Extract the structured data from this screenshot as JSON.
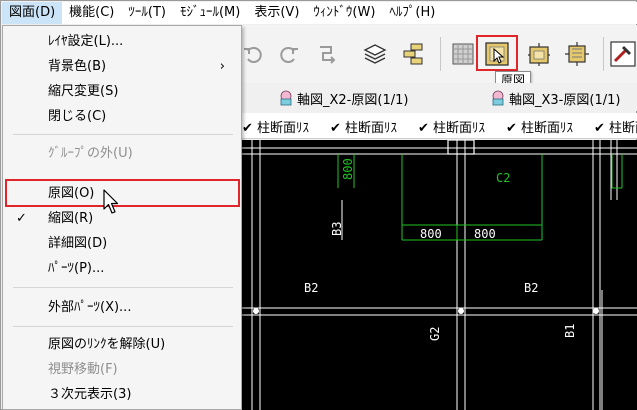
{
  "menubar": {
    "items": [
      "図面(D)",
      "機能(C)",
      "ﾂｰﾙ(T)",
      "ﾓｼﾞｭｰﾙ(M)",
      "表示(V)",
      "ｳｨﾝﾄﾞｳ(W)",
      "ﾍﾙﾌﾟ(H)"
    ]
  },
  "context_menu": {
    "items": [
      {
        "label": "ﾚｲﾔ設定(L)...",
        "disabled": false
      },
      {
        "label": "背景色(B)",
        "disabled": false,
        "submenu": true
      },
      {
        "label": "縮尺変更(S)",
        "disabled": false
      },
      {
        "label": "閉じる(C)",
        "disabled": false
      },
      {
        "label": "ｸﾞﾙｰﾌﾟの外(U)",
        "disabled": true
      },
      {
        "label": "原図(O)",
        "disabled": false,
        "highlighted": true
      },
      {
        "label": "縮図(R)",
        "disabled": false,
        "checked": true
      },
      {
        "label": "詳細図(D)",
        "disabled": false
      },
      {
        "label": "ﾊﾟｰﾂ(P)...",
        "disabled": false
      },
      {
        "label": "外部ﾊﾟｰﾂ(X)...",
        "disabled": false
      },
      {
        "label": "原図のﾘﾝｸを解除(U)",
        "disabled": false
      },
      {
        "label": "視野移動(F)",
        "disabled": true
      },
      {
        "label": "３次元表示(3)",
        "disabled": false
      }
    ],
    "submenu_arrow": "›",
    "check_mark": "✓"
  },
  "tooltip": "原図",
  "tabs": [
    "軸図_X2-原図(1/1)",
    "軸図_X3-原図(1/1)"
  ],
  "column_headers": [
    "柱断面ﾘｽ",
    "柱断面ﾘｽ",
    "柱断面ﾘｽ",
    "柱断面ﾘｽ",
    "柱断面ﾘｽ",
    "柱断"
  ],
  "drawing_labels": {
    "dim_800_top": "800",
    "c2": "C2",
    "b3": "B3",
    "dim_800_a": "800",
    "dim_800_b": "800",
    "b2_left": "B2",
    "b2_right": "B2",
    "g2": "G2",
    "b1": "B1"
  },
  "colors": {
    "highlight": "#e0262b",
    "canvas_bg": "#000000",
    "drawing_line": "#ffffff",
    "dimension_line": "#22c322",
    "menubar_active": "#cce4f7"
  },
  "icons": [
    "undo-icon",
    "redo-icon",
    "repeat-icon",
    "layers-icon",
    "group-icon",
    "hatch-icon",
    "original-view-icon",
    "reduced-view-icon",
    "detail-view-icon",
    "tool-icon"
  ]
}
